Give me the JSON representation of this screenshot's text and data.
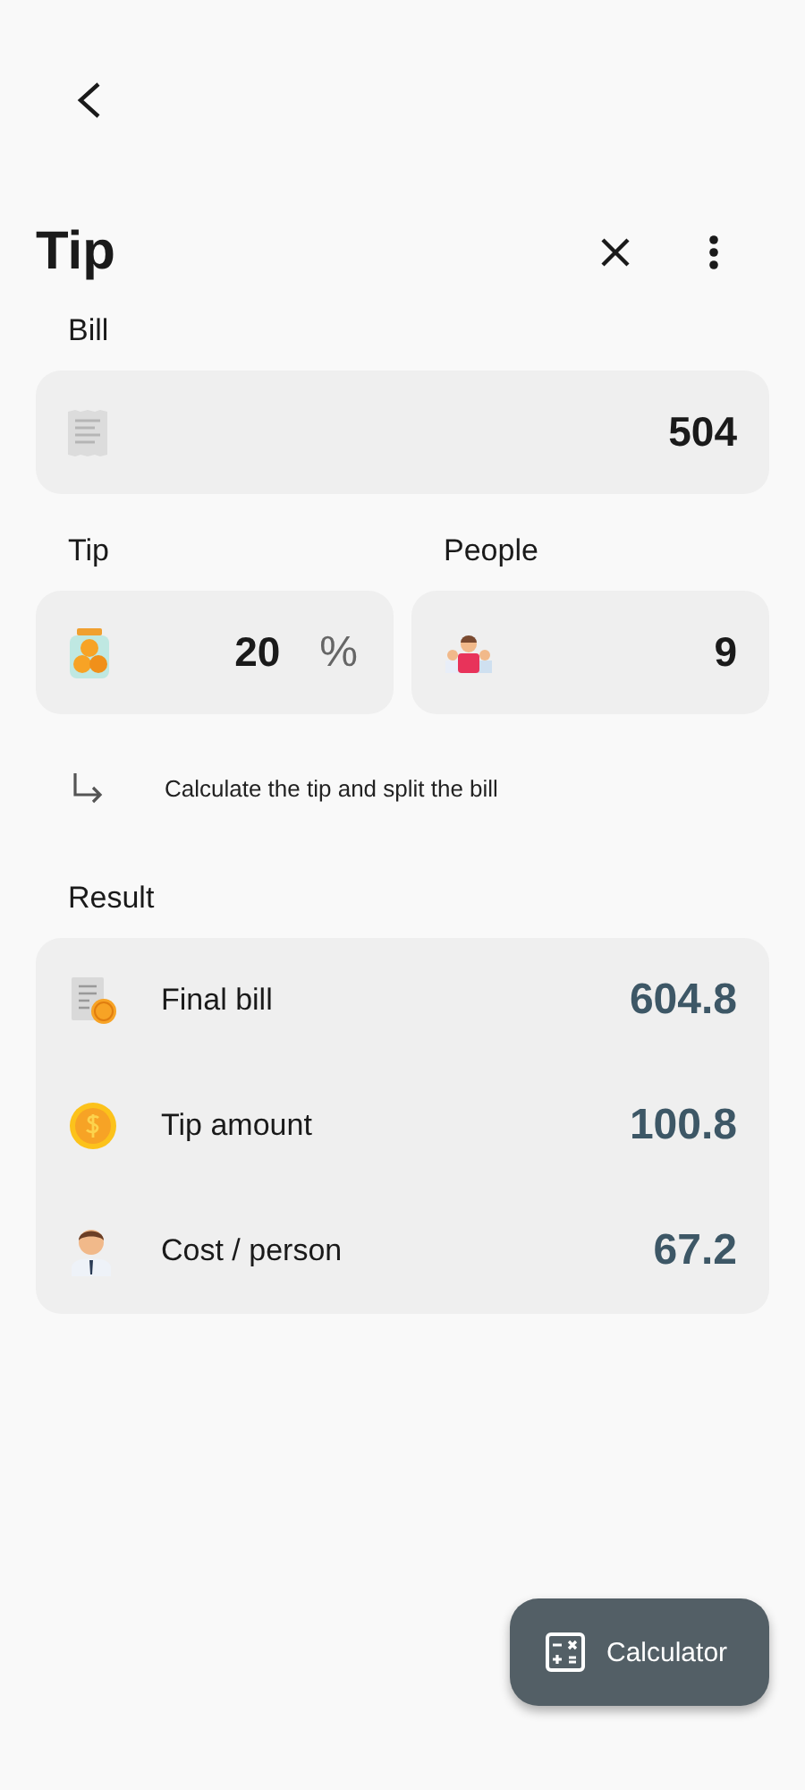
{
  "title": "Tip",
  "bill": {
    "label": "Bill",
    "value": "504"
  },
  "tip": {
    "label": "Tip",
    "value": "20",
    "unit": "%"
  },
  "people": {
    "label": "People",
    "value": "9"
  },
  "hint": "Calculate the tip and split the bill",
  "result": {
    "label": "Result",
    "rows": [
      {
        "label": "Final bill",
        "value": "604.8"
      },
      {
        "label": "Tip amount",
        "value": "100.8"
      },
      {
        "label": "Cost / person",
        "value": "67.2"
      }
    ]
  },
  "fab": {
    "label": "Calculator"
  }
}
